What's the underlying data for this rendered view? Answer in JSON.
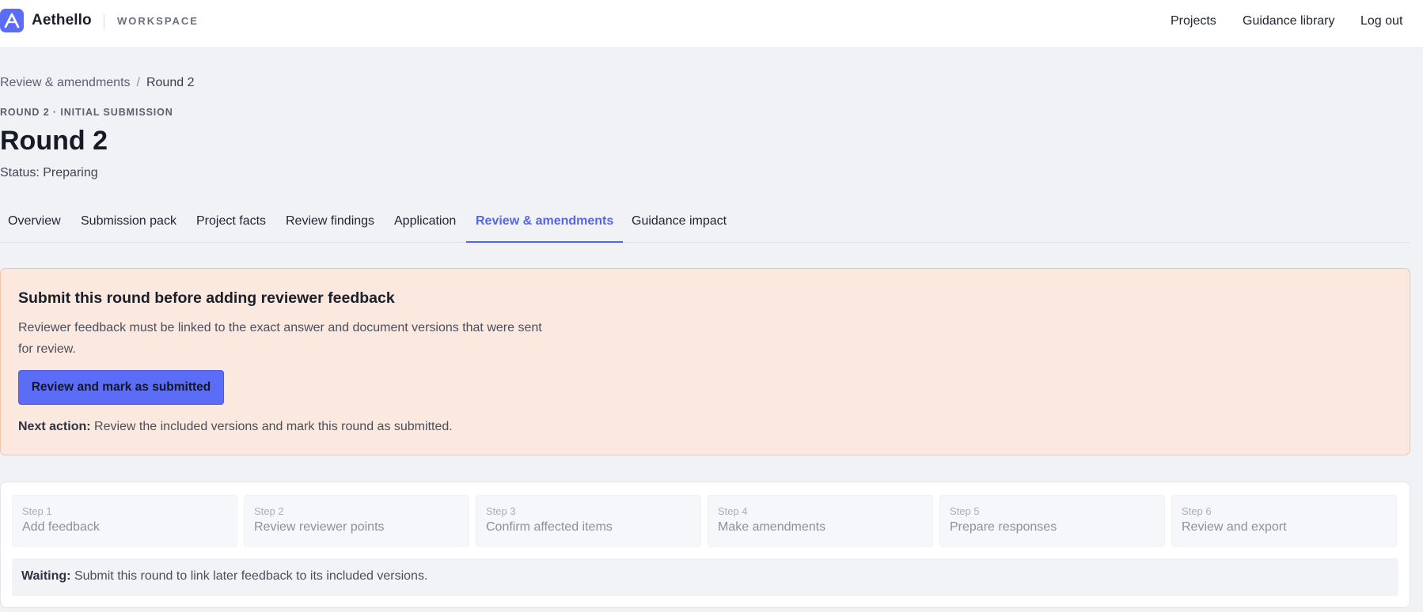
{
  "app": {
    "brand": "Aethello",
    "workspace_label": "WORKSPACE",
    "nav": {
      "projects": "Projects",
      "guidance_library": "Guidance library",
      "logout": "Log out"
    }
  },
  "breadcrumb": {
    "parent": "Review & amendments",
    "separator": "/",
    "current": "Round 2"
  },
  "header": {
    "eyebrow": "ROUND 2 · INITIAL SUBMISSION",
    "title": "Round 2",
    "status": "Status: Preparing"
  },
  "tabs": [
    {
      "label": "Overview",
      "active": false
    },
    {
      "label": "Submission pack",
      "active": false
    },
    {
      "label": "Project facts",
      "active": false
    },
    {
      "label": "Review findings",
      "active": false
    },
    {
      "label": "Application",
      "active": false
    },
    {
      "label": "Review & amendments",
      "active": true
    },
    {
      "label": "Guidance impact",
      "active": false
    }
  ],
  "alert": {
    "title": "Submit this round before adding reviewer feedback",
    "body": "Reviewer feedback must be linked to the exact answer and document versions that were sent for review.",
    "button_label": "Review and mark as submitted",
    "next_action_label": "Next action:",
    "next_action_text": " Review the included versions and mark this round as submitted."
  },
  "steps": [
    {
      "number": "Step 1",
      "label": "Add feedback"
    },
    {
      "number": "Step 2",
      "label": "Review reviewer points"
    },
    {
      "number": "Step 3",
      "label": "Confirm affected items"
    },
    {
      "number": "Step 4",
      "label": "Make amendments"
    },
    {
      "number": "Step 5",
      "label": "Prepare responses"
    },
    {
      "number": "Step 6",
      "label": "Review and export"
    }
  ],
  "waiting": {
    "label": "Waiting:",
    "text": " Submit this round to link later feedback to its included versions."
  },
  "colors": {
    "accent": "#5b6cf6",
    "active_tab": "#5565e8",
    "alert_background": "#fbe8df",
    "alert_border": "#eec3a6",
    "page_background": "#f1f2f6"
  },
  "icons": {
    "logo": "aethello-logo-icon"
  }
}
